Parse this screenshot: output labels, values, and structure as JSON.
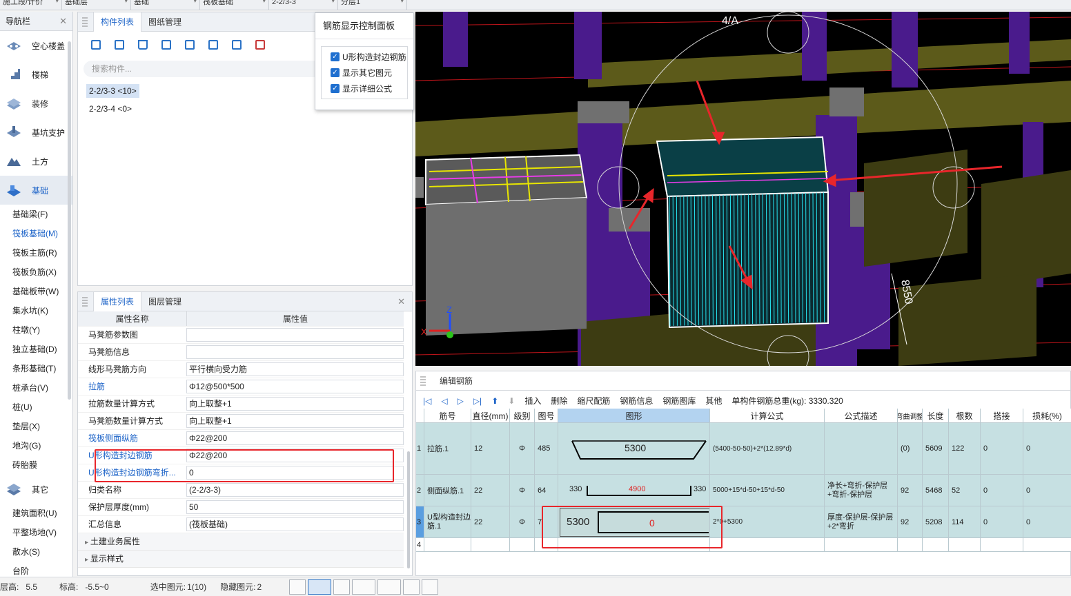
{
  "topbar": {
    "selects": [
      "施工段/计价",
      "基础层",
      "基础",
      "筏板基础",
      "2-2/3-3",
      "分层1"
    ]
  },
  "nav": {
    "title": "导航栏",
    "big_items": [
      "空心楼盖",
      "楼梯",
      "装修",
      "基坑支护",
      "土方",
      "基础",
      "其它"
    ],
    "sub_items_foundation": [
      "基础梁(F)",
      "筏板基础(M)",
      "筏板主筋(R)",
      "筏板负筋(X)",
      "基础板带(W)",
      "集水坑(K)",
      "柱墩(Y)",
      "独立基础(D)",
      "条形基础(T)",
      "桩承台(V)",
      "桩(U)",
      "垫层(X)",
      "地沟(G)",
      "砖胎膜"
    ],
    "sub_items_other": [
      "建筑面积(U)",
      "平整场地(V)",
      "散水(S)",
      "台阶"
    ]
  },
  "clist": {
    "tab_component": "构件列表",
    "tab_drawing": "图纸管理",
    "search_placeholder": "搜索构件...",
    "items": [
      "2-2/3-3 <10>",
      "2-2/3-4 <0>"
    ]
  },
  "popup": {
    "title": "钢筋显示控制面板",
    "options": [
      "U形构造封边钢筋",
      "显示其它图元",
      "显示详细公式"
    ],
    "check_glyph": "✓"
  },
  "props": {
    "tab_props": "属性列表",
    "tab_layers": "图层管理",
    "col_name": "属性名称",
    "col_value": "属性值",
    "rows": [
      {
        "name": "马凳筋参数图",
        "value": ""
      },
      {
        "name": "马凳筋信息",
        "value": ""
      },
      {
        "name": "线形马凳筋方向",
        "value": "平行横向受力筋"
      },
      {
        "name": "拉筋",
        "value": "Φ12@500*500"
      },
      {
        "name": "拉筋数量计算方式",
        "value": "向上取整+1"
      },
      {
        "name": "马凳筋数量计算方式",
        "value": "向上取整+1"
      },
      {
        "name": "筏板侧面纵筋",
        "value": "Φ22@200"
      },
      {
        "name": "U形构造封边钢筋",
        "value": "Φ22@200"
      },
      {
        "name": "U形构造封边钢筋弯折...",
        "value": "0"
      },
      {
        "name": "归类名称",
        "value": "(2-2/3-3)"
      },
      {
        "name": "保护层厚度(mm)",
        "value": "50"
      },
      {
        "name": "汇总信息",
        "value": "(筏板基础)"
      }
    ],
    "groups": [
      "土建业务属性",
      "显示样式"
    ]
  },
  "view": {
    "axis_label": "4/A",
    "dim_label": "8550",
    "axis_z": "Z",
    "axis_x": "X"
  },
  "editor": {
    "title": "编辑钢筋",
    "toolbar": [
      "插入",
      "删除",
      "缩尺配筋",
      "钢筋信息",
      "钢筋图库",
      "其他"
    ],
    "total": "单构件钢筋总重(kg): 3330.320",
    "headers": [
      "筋号",
      "直径(mm)",
      "级别",
      "图号",
      "图形",
      "计算公式",
      "公式描述",
      "弯曲调整",
      "长度",
      "根数",
      "搭接",
      "损耗(%)"
    ],
    "rows": [
      {
        "idx": "1",
        "name": "拉筋.1",
        "dia": "12",
        "grade": "Φ",
        "fig": "485",
        "shape_mid": "5300",
        "formula": "(5400-50-50)+2*(12.89*d)",
        "desc": "",
        "adj": "(0)",
        "len": "5609",
        "count": "122",
        "lap": "0",
        "loss": "0"
      },
      {
        "idx": "2",
        "name": "侧面纵筋.1",
        "dia": "22",
        "grade": "Φ",
        "fig": "64",
        "shape_left": "330",
        "shape_mid": "4900",
        "shape_right": "330",
        "formula": "5000+15*d-50+15*d-50",
        "desc": "净长+弯折-保护层+弯折-保护层",
        "adj": "92",
        "len": "5468",
        "count": "52",
        "lap": "0",
        "loss": "0"
      },
      {
        "idx": "3",
        "name": "U型构造封边筋.1",
        "dia": "22",
        "grade": "Φ",
        "fig": "7",
        "shape_left": "5300",
        "shape_mid": "0",
        "formula": "2*0+5300",
        "desc": "厚度-保护层-保护层+2*弯折",
        "adj": "92",
        "len": "5208",
        "count": "114",
        "lap": "0",
        "loss": "0"
      },
      {
        "idx": "4",
        "name": "",
        "dia": "",
        "grade": "",
        "fig": "",
        "shape_mid": "",
        "formula": "",
        "desc": "",
        "adj": "",
        "len": "",
        "count": "",
        "lap": "",
        "loss": ""
      }
    ]
  },
  "status": {
    "floor_h_label": "层高:",
    "floor_h": "5.5",
    "elev_label": "标高:",
    "elev": "-5.5~0",
    "selected_label": "选中图元:",
    "selected": "1(10)",
    "hidden_label": "隐藏图元:",
    "hidden": "2"
  }
}
